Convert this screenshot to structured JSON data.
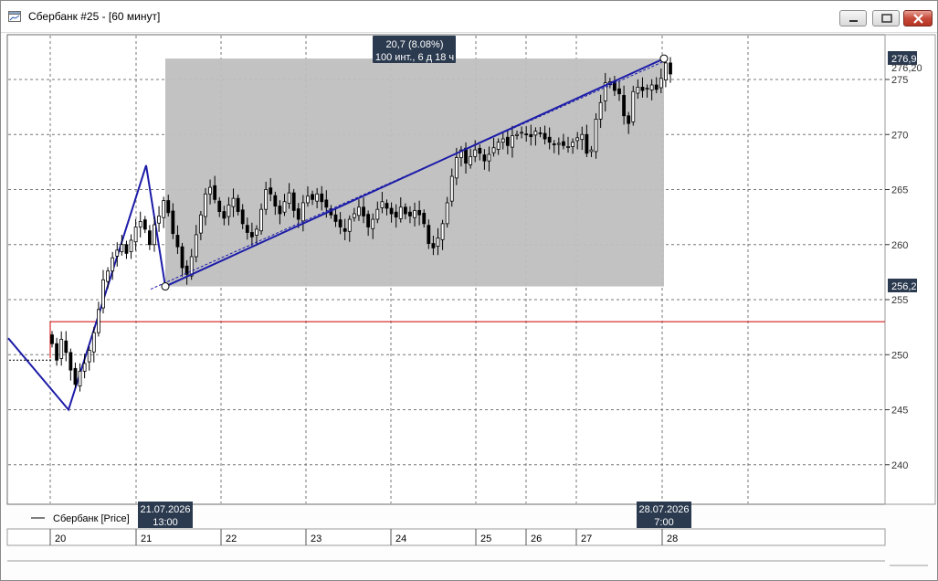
{
  "window": {
    "title": "Сбербанк #25 - [60 минут]"
  },
  "chart_data": {
    "type": "candlestick",
    "ylim": [
      236.5,
      277.5
    ],
    "y_ticks": [
      240,
      245,
      250,
      255,
      260,
      265,
      270,
      275
    ],
    "x_tick_labels": [
      "20",
      "21",
      "22",
      "23",
      "24",
      "25",
      "26",
      "27",
      "28"
    ],
    "legend": {
      "label": "Сбербанк [Price]",
      "placement": "bottom-left"
    },
    "price_badges": [
      "276,9",
      "276,20",
      "256,2"
    ],
    "measure_label": {
      "line1": "20,7 (8.08%)",
      "line2": "100 инт., 6 д 18 ч"
    },
    "cursor_labels": [
      {
        "date": "21.07.2026",
        "time": "13:00"
      },
      {
        "date": "28.07.2026",
        "time": "7:00"
      }
    ],
    "horizontal_level": 253.0,
    "measure_range": {
      "low": 256.2,
      "high": 276.9
    },
    "trend_line": {
      "start": 256.2,
      "end": 276.9
    },
    "colors": {
      "level_line": "#cc0000",
      "trend_line": "#1c1ca8",
      "measure_box": "#bfbfbf",
      "badge_bg": "#2b3a4f",
      "candle": "#000000"
    },
    "zigzag": [
      251.5,
      245.0,
      267.2,
      256.2
    ],
    "candles_close": [
      251.0,
      249.5,
      251.4,
      250.2,
      248.6,
      247.3,
      248.5,
      249.2,
      250.4,
      252.0,
      254.1,
      256.8,
      257.6,
      258.8,
      259.5,
      260.0,
      259.2,
      260.4,
      261.6,
      262.1,
      261.4,
      260.0,
      261.8,
      262.6,
      264.0,
      262.9,
      261.0,
      259.8,
      257.9,
      257.3,
      258.9,
      260.9,
      262.7,
      264.6,
      265.2,
      264.1,
      263.0,
      262.4,
      263.6,
      264.2,
      263.0,
      261.9,
      261.1,
      260.7,
      261.4,
      263.2,
      265.0,
      264.6,
      263.5,
      262.8,
      263.9,
      264.7,
      263.1,
      262.3,
      263.8,
      264.4,
      264.1,
      264.6,
      263.9,
      263.4,
      262.7,
      262.1,
      261.6,
      261.2,
      262.3,
      262.8,
      263.4,
      262.6,
      261.6,
      262.3,
      263.2,
      263.9,
      263.3,
      262.8,
      262.5,
      263.4,
      262.8,
      262.6,
      263.1,
      262.7,
      261.9,
      260.1,
      259.7,
      260.6,
      261.9,
      263.8,
      266.2,
      267.9,
      268.6,
      267.4,
      268.0,
      268.6,
      268.3,
      267.6,
      268.2,
      268.8,
      269.3,
      269.6,
      269.0,
      269.9,
      270.0,
      270.2,
      270.0,
      269.8,
      270.3,
      270.1,
      269.6,
      269.3,
      269.1,
      269.2,
      269.0,
      268.9,
      269.3,
      269.7,
      270.0,
      268.3,
      268.6,
      271.4,
      272.9,
      274.7,
      274.8,
      274.0,
      273.7,
      271.7,
      271.0,
      273.9,
      274.3,
      274.0,
      274.2,
      274.5,
      274.1,
      275.1,
      276.5,
      275.5
    ]
  }
}
